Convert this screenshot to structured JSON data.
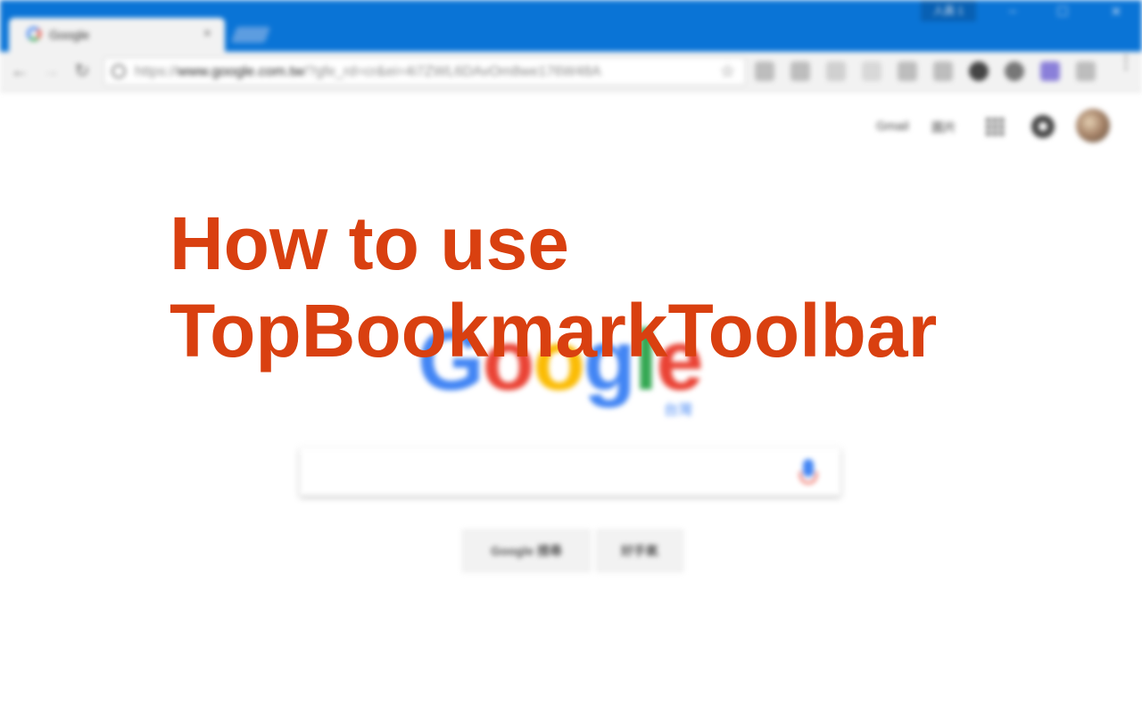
{
  "browser": {
    "profile_label": "人員 1",
    "tab": {
      "title": "Google",
      "close": "×"
    },
    "window_controls": {
      "minimize": "–",
      "maximize": "☐",
      "close": "✕"
    },
    "nav": {
      "back": "←",
      "forward": "→",
      "reload": "↻"
    },
    "url": {
      "scheme": "https://",
      "domain": "www.google.com.tw",
      "path": "/?gfe_rd=cr&ei=4i7ZWL6DAvOm8we176W48A"
    },
    "menu": "⋮"
  },
  "google": {
    "gbar": {
      "gmail": "Gmail",
      "images": "圖片"
    },
    "logo_letters": [
      {
        "char": "G",
        "color": "#4285f4"
      },
      {
        "char": "o",
        "color": "#ea4335"
      },
      {
        "char": "o",
        "color": "#fbbc05"
      },
      {
        "char": "g",
        "color": "#4285f4"
      },
      {
        "char": "l",
        "color": "#34a853"
      },
      {
        "char": "e",
        "color": "#ea4335"
      }
    ],
    "logo_region": "台灣",
    "search_button": "Google 搜尋",
    "lucky_button": "好手氣"
  },
  "overlay": {
    "line1": "How to use",
    "line2": "TopBookmarkToolbar",
    "color": "#d94010"
  },
  "colors": {
    "titlebar": "#0a74d6",
    "toolbar": "#f2f2f2"
  }
}
